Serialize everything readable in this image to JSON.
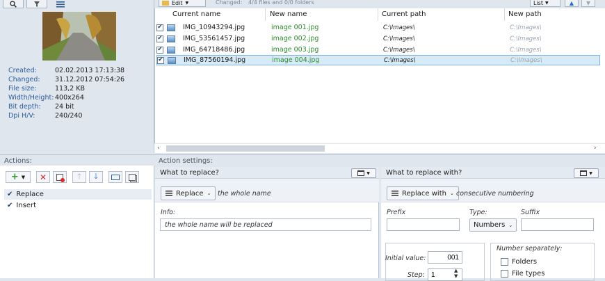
{
  "toolbar": {
    "edit_label": "Edit",
    "changed_label": "Changed:",
    "changed_value": "4/4 files and 0/0 folders",
    "view_label": "List"
  },
  "preview": {
    "info": [
      {
        "key": "Created:",
        "value": "02.02.2013 17:13:38"
      },
      {
        "key": "Changed:",
        "value": "31.12.2012 07:54:26"
      },
      {
        "key": "File size:",
        "value": "113,2 KB"
      },
      {
        "key": "Width/Height:",
        "value": "400x264"
      },
      {
        "key": "Bit depth:",
        "value": "24 bit"
      },
      {
        "key": "Dpi H/V:",
        "value": "240/240"
      }
    ]
  },
  "file_list": {
    "columns": [
      "Current name",
      "New name",
      "Current path",
      "New path"
    ],
    "rows": [
      {
        "current": "IMG_10943294.jpg",
        "new": "image 001.jpg",
        "cpath": "C:\\Images\\",
        "npath": "C:\\Images\\"
      },
      {
        "current": "IMG_53561457.jpg",
        "new": "image 002.jpg",
        "cpath": "C:\\Images\\",
        "npath": "C:\\Images\\"
      },
      {
        "current": "IMG_64718486.jpg",
        "new": "image 003.jpg",
        "cpath": "C:\\Images\\",
        "npath": "C:\\Images\\"
      },
      {
        "current": "IMG_87560194.jpg",
        "new": "image 004.jpg",
        "cpath": "C:\\Images\\",
        "npath": "C:\\Images\\"
      }
    ]
  },
  "actions": {
    "header": "Actions:",
    "items": [
      {
        "label": "Replace"
      },
      {
        "label": "Insert"
      }
    ]
  },
  "settings": {
    "header": "Action settings:",
    "what_to_replace": {
      "title": "What to replace?",
      "mode": "Replace",
      "mode_desc": "the whole name",
      "info_label": "Info:",
      "info_text": "the whole name will be replaced"
    },
    "replace_with": {
      "title": "What to replace with?",
      "mode": "Replace with",
      "mode_desc": "consecutive numbering",
      "prefix_label": "Prefix",
      "type_label": "Type:",
      "type_value": "Numbers",
      "suffix_label": "Suffix",
      "initial_label": "Initial value:",
      "initial_value": "001",
      "step_label": "Step:",
      "step_value": "1",
      "separately_label": "Number separately:",
      "opt_folders": "Folders",
      "opt_filetypes": "File types"
    }
  },
  "colors": {
    "accent": "#2a5c9a",
    "new_name": "#2e8b2e",
    "selection": "#d6eaf8"
  }
}
